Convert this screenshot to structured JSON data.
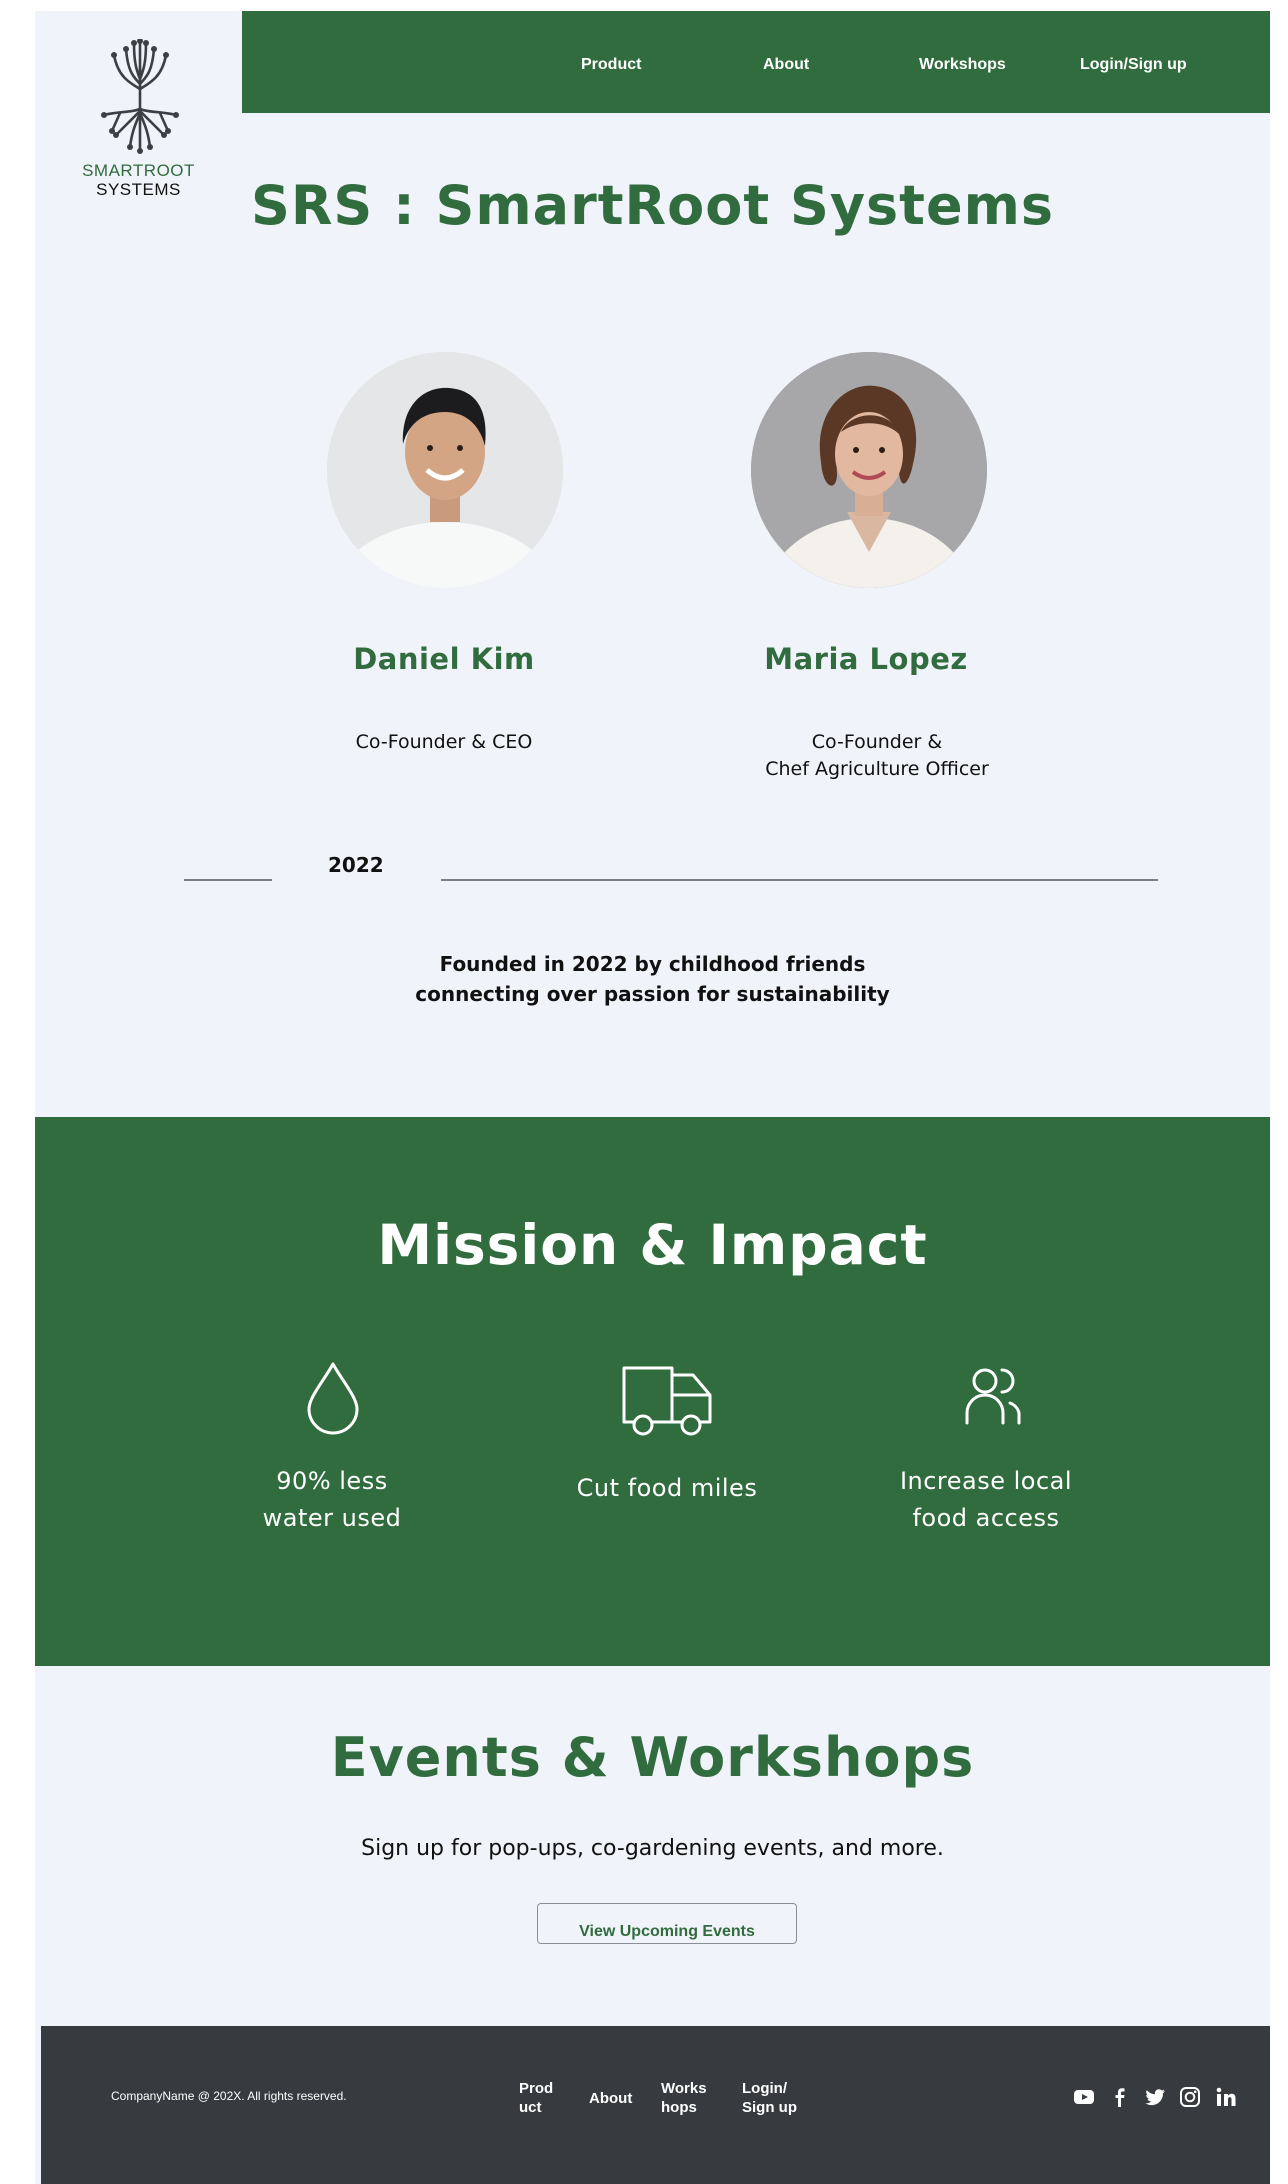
{
  "brand": {
    "line1": "SMARTROOT",
    "line2": "SYSTEMS"
  },
  "nav": {
    "items": [
      {
        "label": "Product"
      },
      {
        "label": "About"
      },
      {
        "label": "Workshops"
      },
      {
        "label": "Login/Sign up"
      }
    ]
  },
  "hero": {
    "title": "SRS : SmartRoot Systems"
  },
  "team": [
    {
      "name": "Daniel Kim",
      "role_line1": "Co-Founder & CEO",
      "role_line2": ""
    },
    {
      "name": "Maria Lopez",
      "role_line1": "Co-Founder &",
      "role_line2": "Chef Agriculture Officer"
    }
  ],
  "timeline": {
    "year": "2022"
  },
  "founded": {
    "line1": "Founded in 2022 by childhood friends",
    "line2": "connecting over passion for sustainability"
  },
  "mission": {
    "title": "Mission & Impact",
    "items": [
      {
        "icon": "water-drop-icon",
        "line1": "90% less",
        "line2": "water used"
      },
      {
        "icon": "truck-icon",
        "line1": "Cut food miles",
        "line2": ""
      },
      {
        "icon": "users-icon",
        "line1": "Increase local",
        "line2": "food access"
      }
    ]
  },
  "events": {
    "title": "Events & Workshops",
    "subtitle": "Sign up for pop-ups, co-gardening events, and more.",
    "button_label": "View Upcoming Events"
  },
  "footer": {
    "copyright": "CompanyName @ 202X. All rights reserved.",
    "nav": [
      {
        "line1": "Prod",
        "line2": "uct"
      },
      {
        "line1": "About",
        "line2": ""
      },
      {
        "line1": "Works",
        "line2": "hops"
      },
      {
        "line1": "Login/",
        "line2": "Sign up"
      }
    ],
    "social": [
      "youtube-icon",
      "facebook-icon",
      "twitter-icon",
      "instagram-icon",
      "linkedin-icon"
    ]
  },
  "colors": {
    "brand_green": "#316c3e",
    "background": "#f0f3f9",
    "footer_bg": "#373b40",
    "text_dark": "#111111"
  }
}
